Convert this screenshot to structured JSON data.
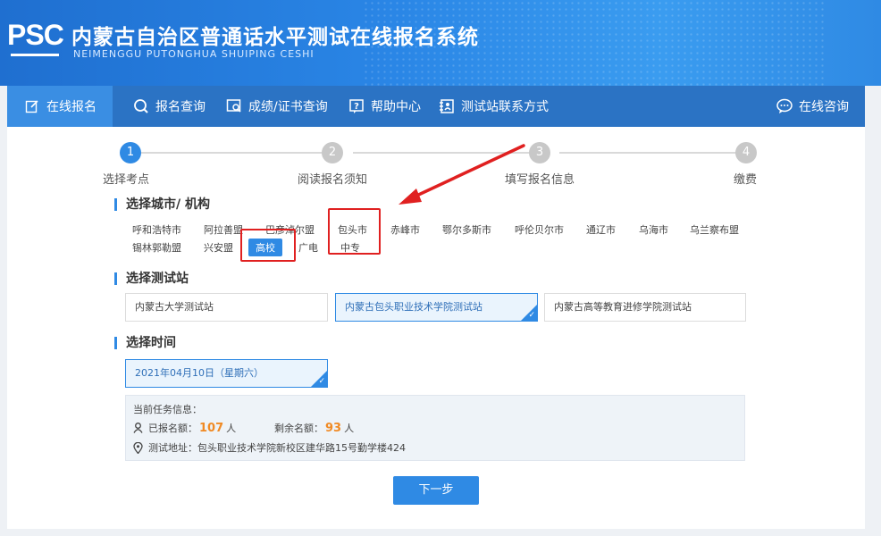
{
  "header": {
    "logo": "PSC",
    "title": "内蒙古自治区普通话水平测试在线报名系统",
    "subtitle": "NEIMENGGU PUTONGHUA SHUIPING CESHI"
  },
  "nav": {
    "items": [
      {
        "label": "在线报名",
        "icon": "edit-icon"
      },
      {
        "label": "报名查询",
        "icon": "search-icon"
      },
      {
        "label": "成绩/证书查询",
        "icon": "certificate-icon"
      },
      {
        "label": "帮助中心",
        "icon": "help-icon"
      },
      {
        "label": "测试站联系方式",
        "icon": "contact-icon"
      }
    ],
    "consult": {
      "label": "在线咨询",
      "icon": "chat-icon"
    }
  },
  "steps": [
    {
      "num": "1",
      "label": "选择考点",
      "active": true
    },
    {
      "num": "2",
      "label": "阅读报名须知",
      "active": false
    },
    {
      "num": "3",
      "label": "填写报名信息",
      "active": false
    },
    {
      "num": "4",
      "label": "缴费",
      "active": false
    }
  ],
  "section_city": "选择城市/ 机构",
  "cities_row1": [
    "呼和浩特市",
    "阿拉善盟",
    "巴彦淖尔盟",
    "包头市",
    "赤峰市",
    "鄂尔多斯市",
    "呼伦贝尔市",
    "通辽市",
    "乌海市",
    "乌兰察布盟"
  ],
  "cities_row2": [
    "锡林郭勒盟",
    "兴安盟",
    "高校",
    "广电",
    "中专"
  ],
  "section_site": "选择测试站",
  "sites": [
    "内蒙古大学测试站",
    "内蒙古包头职业技术学院测试站",
    "内蒙古高等教育进修学院测试站"
  ],
  "section_time": "选择时间",
  "time": "2021年04月10日（星期六）",
  "info": {
    "heading": "当前任务信息：",
    "registered_label": "已报名额：",
    "registered_value": "107",
    "registered_unit": "人",
    "remaining_label": "剩余名额：",
    "remaining_value": "93",
    "remaining_unit": "人",
    "address": "测试地址：包头职业技术学院新校区建华路15号勤学楼424"
  },
  "next_button": "下一步",
  "colors": {
    "primary": "#2f8ae4",
    "highlight": "#f08a24",
    "annotation": "#e02020"
  }
}
